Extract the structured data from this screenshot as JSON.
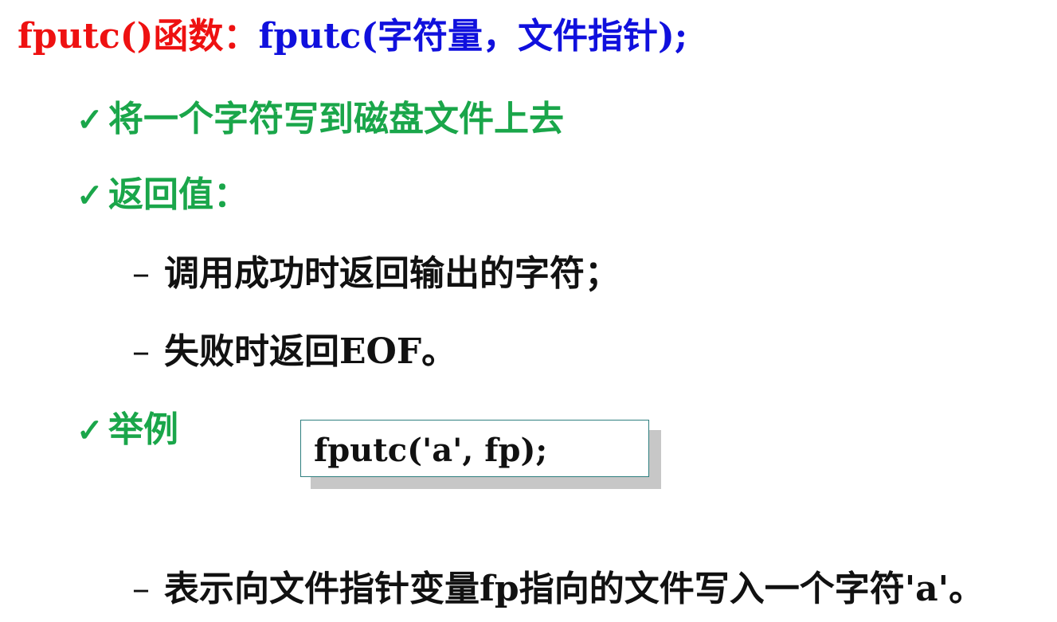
{
  "title": {
    "func_label": "fputc()函数：",
    "signature": "fputc(字符量，文件指针);"
  },
  "bullets": {
    "check_glyph": "✓",
    "dash_glyph": "–",
    "purpose": "将一个字符写到磁盘文件上去",
    "return_value": "返回值：",
    "success": "调用成功时返回输出的字符；",
    "failure": "失败时返回EOF。",
    "example": "举例",
    "explanation": "表示向文件指针变量fp指向的文件写入一个字符'a'。"
  },
  "code_example": "fputc('a', fp);",
  "colors": {
    "red": "#ee1111",
    "blue": "#1010dd",
    "green": "#1aa64a",
    "black": "#111111",
    "box_border": "#2f7f7f"
  }
}
